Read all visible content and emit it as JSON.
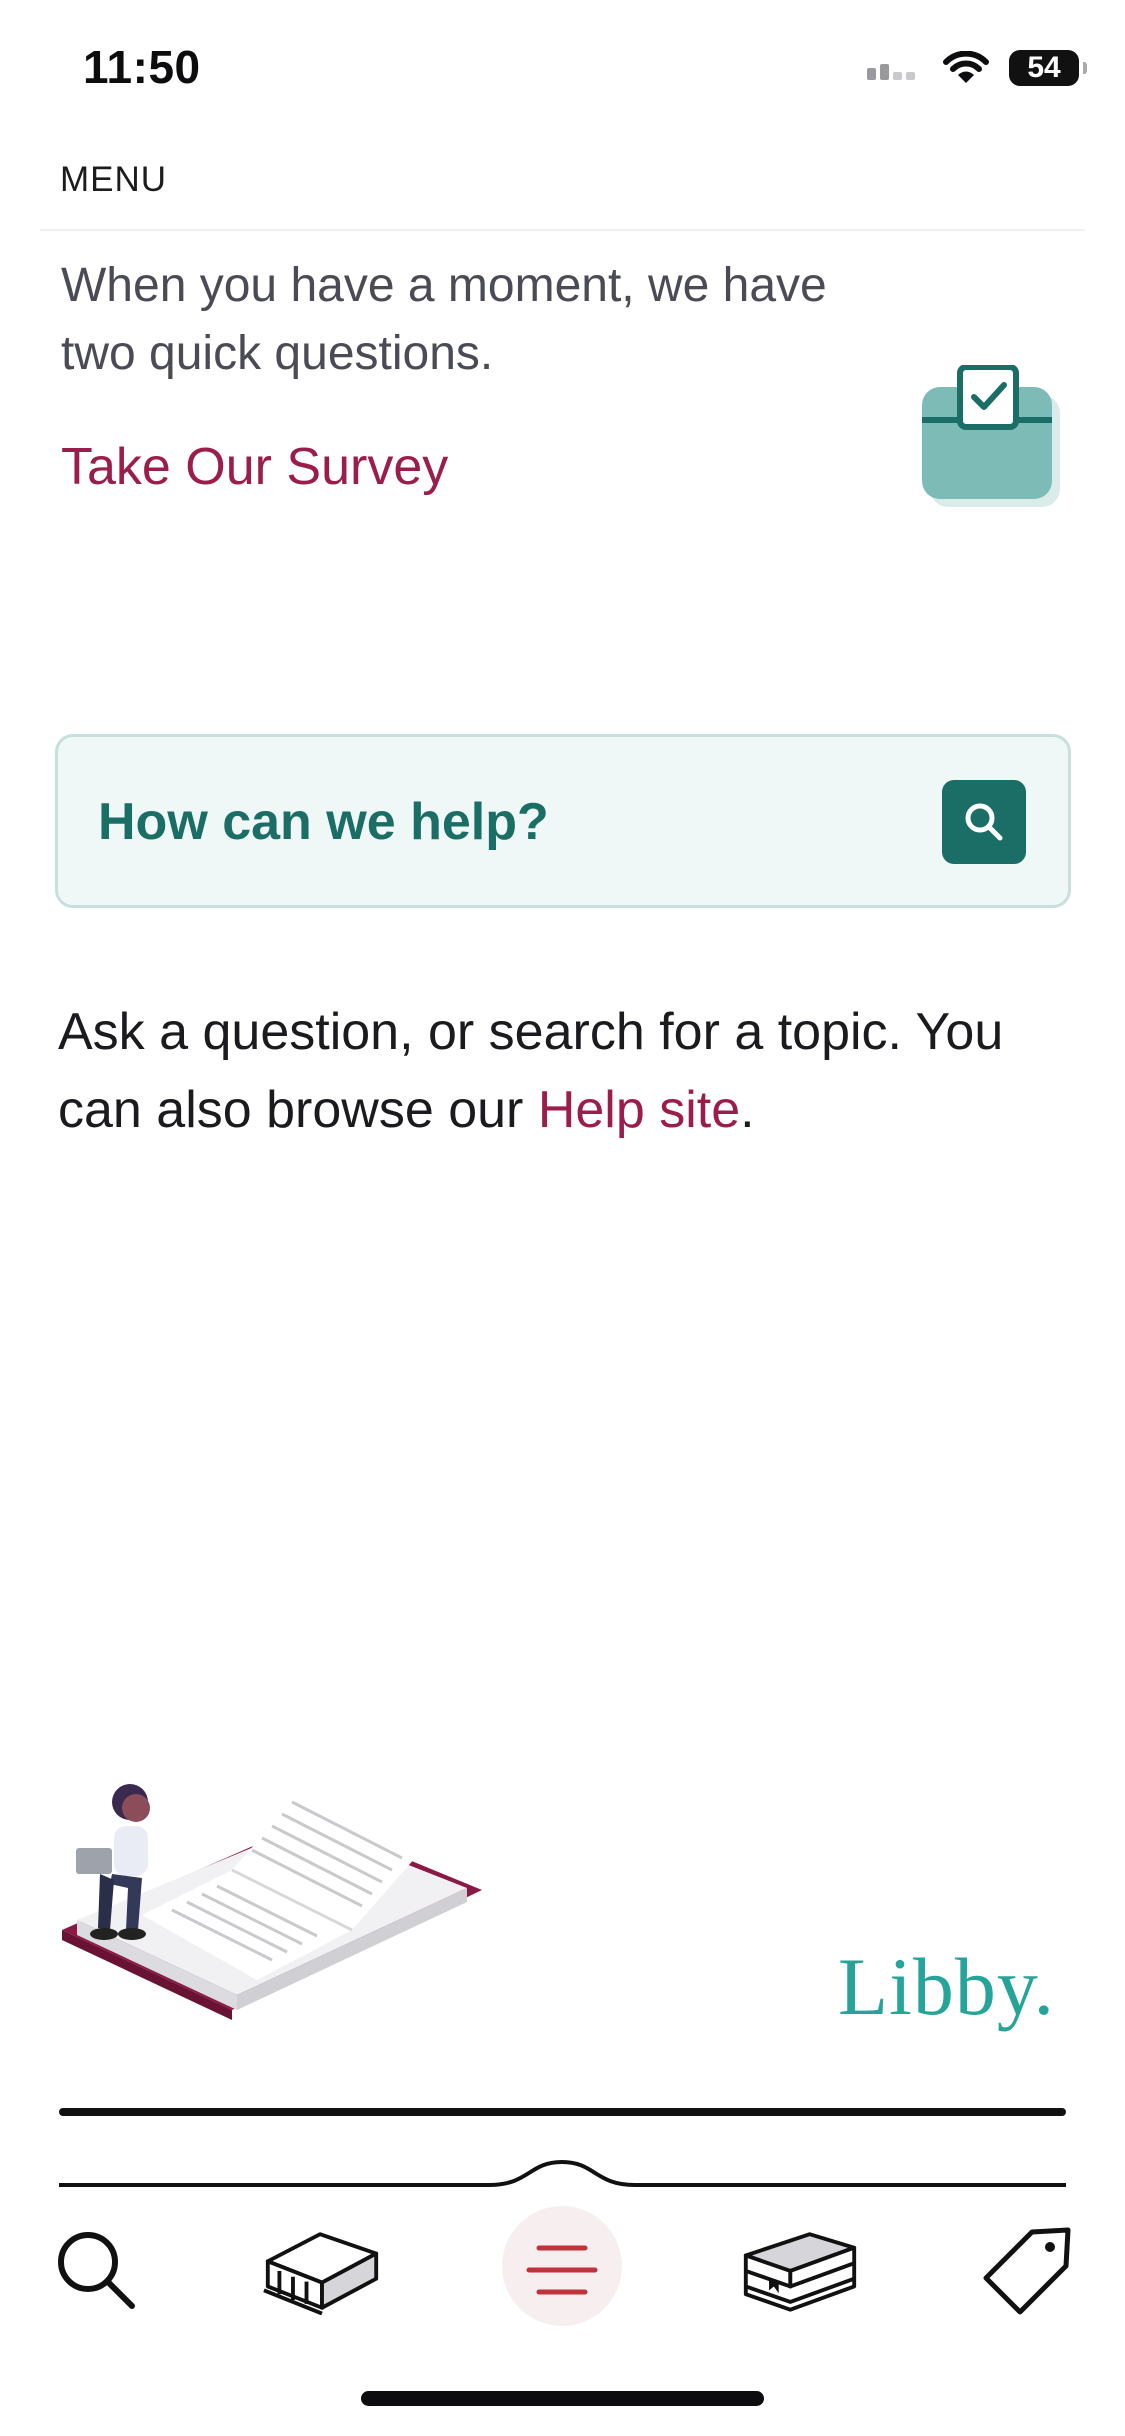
{
  "status_bar": {
    "time": "11:50",
    "battery": "54"
  },
  "header": {
    "menu_label": "MENU"
  },
  "survey": {
    "prompt": "When you have a moment, we have two quick questions.",
    "link_label": "Take Our Survey",
    "illustration": "clipboard-check-icon"
  },
  "help": {
    "search_placeholder": "How can we help?",
    "search_icon": "search-icon",
    "description_prefix": "Ask a question, or search for a topic. You can also browse our ",
    "description_link": "Help site",
    "description_suffix": "."
  },
  "branding": {
    "logo_text": "Libby."
  },
  "bottom_nav": {
    "items": [
      {
        "name": "search",
        "icon": "search-icon"
      },
      {
        "name": "libraries",
        "icon": "library-icon"
      },
      {
        "name": "menu",
        "icon": "menu-icon",
        "active": true
      },
      {
        "name": "shelf",
        "icon": "books-icon"
      },
      {
        "name": "tags",
        "icon": "tag-icon"
      }
    ]
  },
  "colors": {
    "accent_link": "#9b1d4c",
    "teal": "#1a6e66",
    "logo_teal": "#27a49a",
    "help_bg": "#eff8f6"
  }
}
